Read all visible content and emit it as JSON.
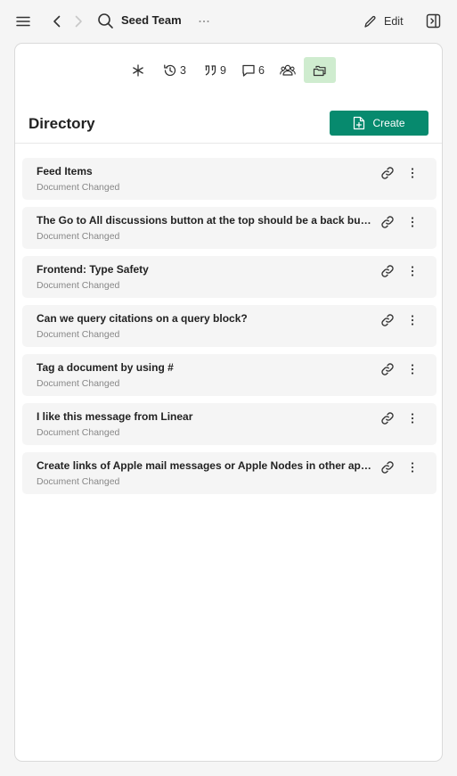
{
  "header": {
    "title": "Seed Team",
    "edit_label": "Edit"
  },
  "tabs": [
    {
      "icon": "asterisk-icon",
      "count": ""
    },
    {
      "icon": "history-icon",
      "count": "3"
    },
    {
      "icon": "quote-icon",
      "count": "9"
    },
    {
      "icon": "comment-icon",
      "count": "6"
    },
    {
      "icon": "users-icon",
      "count": ""
    },
    {
      "icon": "folders-icon",
      "count": ""
    }
  ],
  "directory": {
    "title": "Directory",
    "create_label": "Create",
    "items": [
      {
        "title": "Feed Items",
        "subtitle": "Document Changed"
      },
      {
        "title": "The Go to All discussions button at the top should be a back button",
        "subtitle": "Document Changed"
      },
      {
        "title": "Frontend: Type Safety",
        "subtitle": "Document Changed"
      },
      {
        "title": "Can we query citations on a query block?",
        "subtitle": "Document Changed"
      },
      {
        "title": "Tag a document by using #",
        "subtitle": "Document Changed"
      },
      {
        "title": "I like this message from Linear",
        "subtitle": "Document Changed"
      },
      {
        "title": "Create links of Apple mail messages or Apple Nodes in other apps",
        "subtitle": "Document Changed"
      }
    ]
  },
  "colors": {
    "accent": "#078a6e",
    "active_tab": "#cfeccf"
  }
}
